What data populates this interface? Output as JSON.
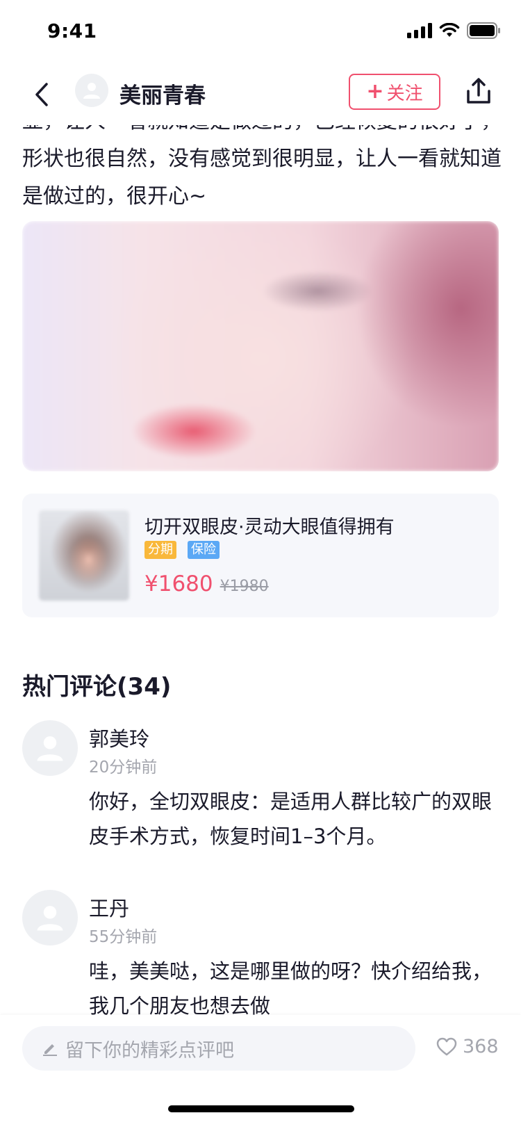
{
  "status_bar": {
    "time": "9:41"
  },
  "nav": {
    "username": "美丽青春",
    "follow_plus": "+",
    "follow_label": "关注"
  },
  "post": {
    "text": "显，让人一看就知道是做过的，已经恢复的很好了，形状也很自然，没有感觉到很明显，让人一看就知道是做过的，很开心~"
  },
  "product": {
    "title": "切开双眼皮·灵动大眼值得拥有",
    "tags": [
      "分期",
      "保险"
    ],
    "price": "¥1680",
    "original_price": "¥1980"
  },
  "comments": {
    "title": "热门评论(34)",
    "items": [
      {
        "name": "郭美玲",
        "time": "20分钟前",
        "body": "你好，全切双眼皮：是适用人群比较广的双眼皮手术方式，恢复时间1–3个月。"
      },
      {
        "name": "王丹",
        "time": "55分钟前",
        "body": "哇，美美哒，这是哪里做的呀？快介绍给我，我几个朋友也想去做"
      }
    ]
  },
  "bottom_bar": {
    "placeholder": "留下你的精彩点评吧",
    "like_count": "368"
  },
  "colors": {
    "accent": "#f0506e",
    "tag_installment": "#f9b83b",
    "tag_insurance": "#5ba8f5",
    "muted_text": "#a4a6ae"
  },
  "icons": [
    "back-icon",
    "user-icon",
    "share-icon",
    "signal-icon",
    "wifi-icon",
    "battery-icon",
    "pencil-icon",
    "heart-icon"
  ]
}
